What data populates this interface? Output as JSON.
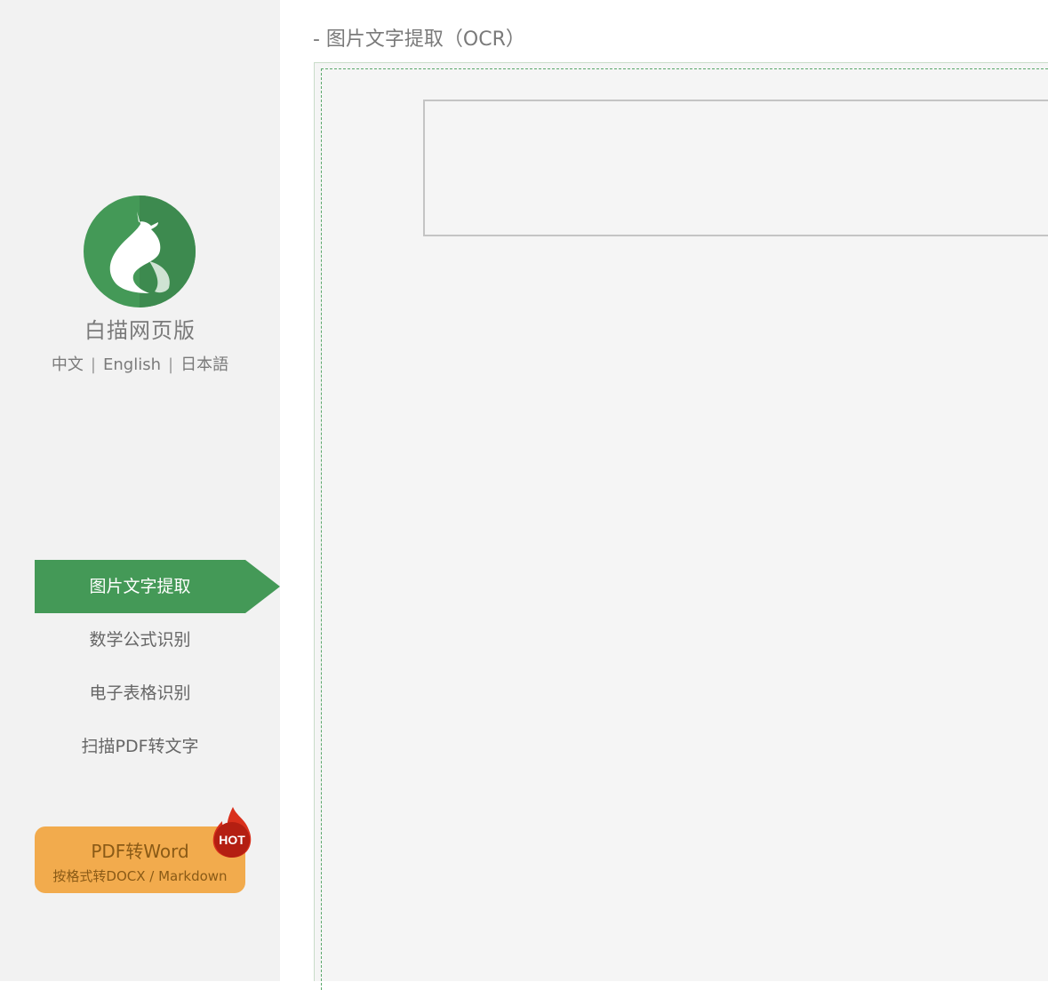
{
  "sidebar": {
    "app_name": "白描网页版",
    "languages": [
      "中文",
      "English",
      "日本語"
    ],
    "language_separator": "|",
    "nav_items": [
      {
        "label": "图片文字提取",
        "active": true
      },
      {
        "label": "数学公式识别",
        "active": false
      },
      {
        "label": "电子表格识别",
        "active": false
      },
      {
        "label": "扫描PDF转文字",
        "active": false
      }
    ],
    "promo": {
      "title": "PDF转Word",
      "subtitle": "按格式转DOCX / Markdown",
      "badge": "HOT"
    }
  },
  "main": {
    "title": "- 图片文字提取（OCR）"
  },
  "colors": {
    "accent_green": "#449957",
    "promo_orange": "#f2ab4d",
    "hot_red": "#c0261a"
  },
  "icons": {
    "logo": "cat-logo-icon",
    "hot": "flame-icon"
  }
}
